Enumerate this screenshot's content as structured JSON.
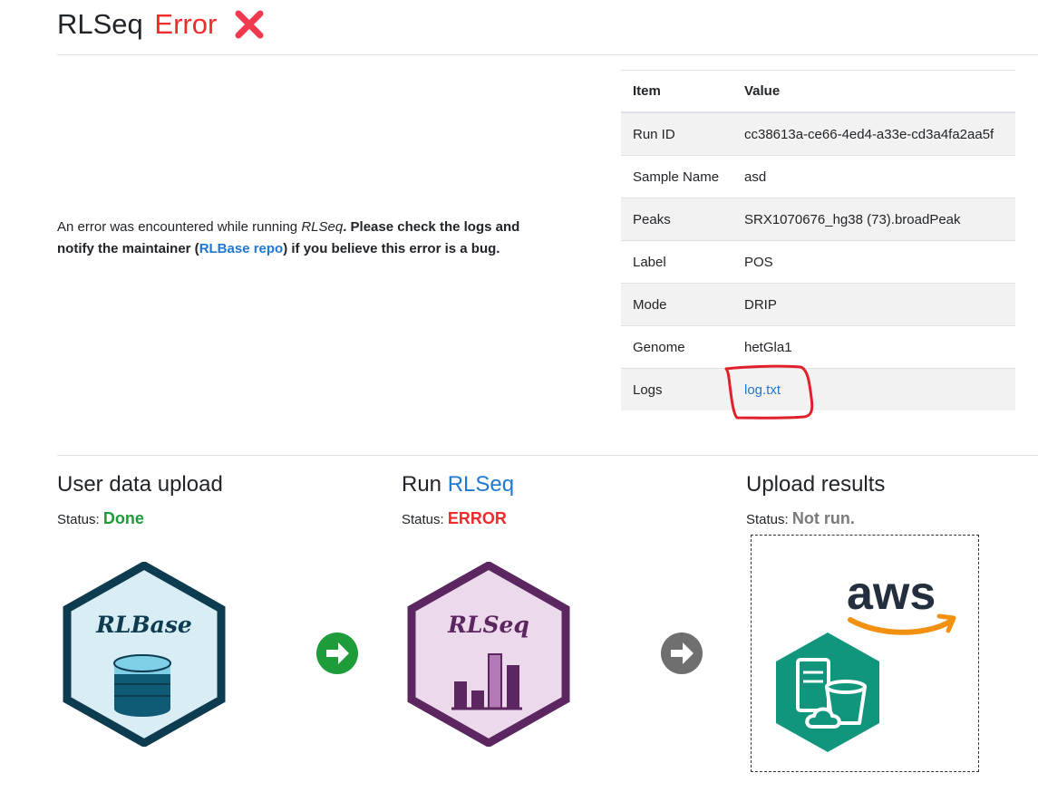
{
  "header": {
    "title": "RLSeq",
    "status_word": "Error",
    "status_icon": "cross-mark-icon"
  },
  "message": {
    "prefix": "An error was encountered while running ",
    "tool": "RLSeq",
    "bold_1": ". Please check the logs and notify the maintainer (",
    "repo_link": "RLBase repo",
    "bold_2": ") if you believe this error is a bug."
  },
  "info_table": {
    "headers": [
      "Item",
      "Value"
    ],
    "rows": [
      {
        "item": "Run ID",
        "value": "cc38613a-ce66-4ed4-a33e-cd3a4fa2aa5f"
      },
      {
        "item": "Sample Name",
        "value": "asd"
      },
      {
        "item": "Peaks",
        "value": "SRX1070676_hg38 (73).broadPeak"
      },
      {
        "item": "Label",
        "value": "POS"
      },
      {
        "item": "Mode",
        "value": "DRIP"
      },
      {
        "item": "Genome",
        "value": "hetGla1"
      },
      {
        "item": "Logs",
        "value": "log.txt"
      }
    ]
  },
  "steps": [
    {
      "title": "User data upload",
      "title_link": "",
      "status_label": "Status:",
      "status_value": "Done",
      "logo_text": "RLBase",
      "arrow_color": "#1e9c3a"
    },
    {
      "title": "Run ",
      "title_link": "RLSeq",
      "status_label": "Status:",
      "status_value": "ERROR",
      "logo_text": "RLSeq",
      "arrow_color": "#6f6f6f"
    },
    {
      "title": "Upload results",
      "title_link": "",
      "status_label": "Status:",
      "status_value": "Not run.",
      "logo_text": "aws"
    }
  ],
  "colors": {
    "accent": "#1e78d4",
    "error": "#f02b2b",
    "done": "#1e9c3a",
    "notrun": "#7a7a7a",
    "annotation": "#e0202a"
  }
}
